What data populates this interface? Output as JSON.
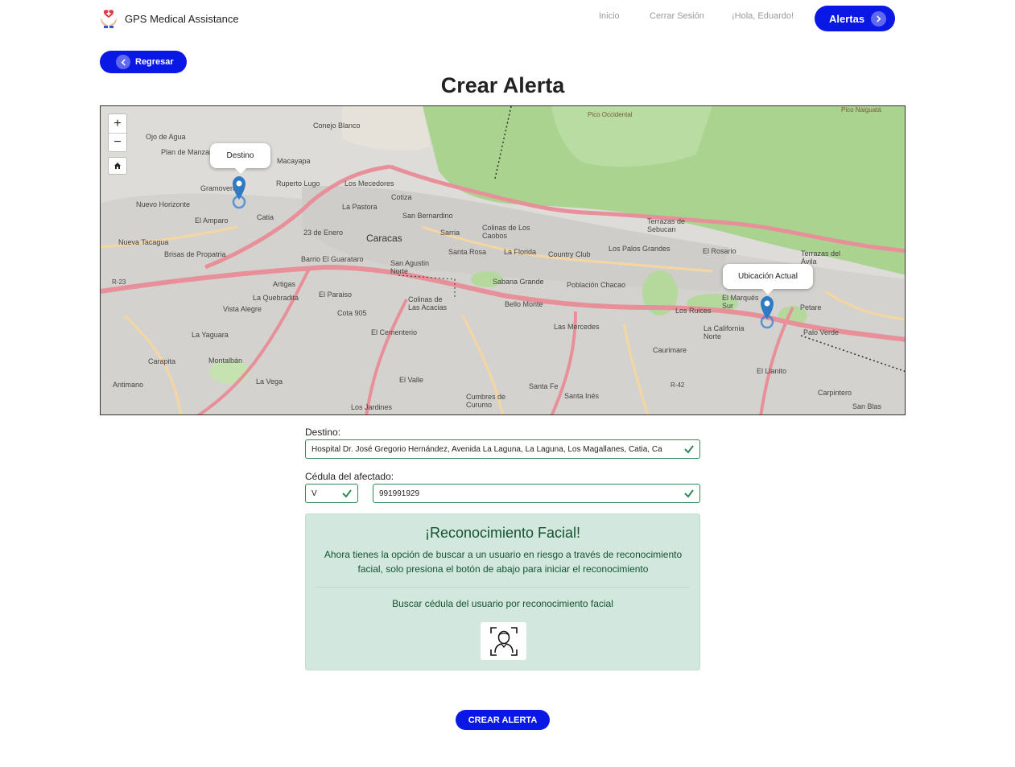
{
  "header": {
    "brand": "GPS Medical Assistance",
    "nav": {
      "home": "Inicio",
      "logout": "Cerrar Sesión",
      "greeting": "¡Hola, Eduardo!"
    },
    "alerts_button": "Alertas"
  },
  "back_button": "Regresar",
  "page_title": "Crear Alerta",
  "map": {
    "zoom_in": "+",
    "zoom_out": "−",
    "destination_popup": "Destino",
    "current_popup": "Ubicación Actual",
    "labels": {
      "caracas": "Caracas",
      "catia": "Catia",
      "gramoven": "Gramoven",
      "macayapa": "Macayapa",
      "ruperto_lugo": "Ruperto Lugo",
      "los_mecedores": "Los Mecedores",
      "conejo_blanco": "Conejo Blanco",
      "ojo_de_agua": "Ojo de Agua",
      "plan_de_manzano": "Plan de Manzano",
      "nuevo_horizonte": "Nuevo Horizonte",
      "el_amparo": "El Amparo",
      "nueva_tacagua": "Nueva Tacagua",
      "brisas_de_propatria": "Brisas de Propatria",
      "cotiza": "Cotiza",
      "la_pastora": "La Pastora",
      "san_bernardino": "San Bernardino",
      "23_de_enero": "23 de Enero",
      "sarria": "Sarria",
      "colinas_de_los_caobos": "Colinas de Los Caobos",
      "barrio_el_guarataro": "Barrio El Guarataro",
      "san_agustin_norte": "San Agustin Norte",
      "santa_rosa": "Santa Rosa",
      "la_florida": "La Florida",
      "country_club": "Country Club",
      "los_palos_grandes": "Los Palos Grandes",
      "el_rosario": "El Rosario",
      "terrazas_de_sebucan": "Terrazas de Sebucan",
      "terrazas_del_avila": "Terrazas del Ávila",
      "artigas": "Artigas",
      "la_quebradita": "La Quebradita",
      "el_paraiso": "El Paraiso",
      "vista_alegre": "Vista Alegre",
      "cota_905": "Cota 905",
      "colinas_de_las_acacias": "Colinas de Las Acacias",
      "sabana_grande": "Sabana Grande",
      "bello_monte": "Bello Monte",
      "poblacion_chacao": "Población Chacao",
      "los_ruices": "Los Ruices",
      "el_marques_sur": "El Marqués Sur",
      "petare": "Petare",
      "palo_verde": "Palo Verde",
      "la_california_norte": "La California Norte",
      "las_mercedes": "Las Mercedes",
      "caurimare": "Caurimare",
      "la_yaguara": "La Yaguara",
      "el_cementerio": "El Cementerio",
      "carapita": "Carapita",
      "montalban": "Montalbán",
      "antimano": "Antimano",
      "la_vega": "La Vega",
      "el_valle": "El Valle",
      "santa_fe": "Santa Fe",
      "santa_ines": "Santa Inés",
      "cumbres_de_curumo": "Cumbres de Curumo",
      "los_jardines": "Los Jardines",
      "el_llanito": "El Llanito",
      "carpintero": "Carpintero",
      "san_blas": "San Blas",
      "pico_occidental": "Pico Occidental",
      "pico_naiguata": "Pico Naiguatá",
      "r23": "R-23",
      "r42": "R-42"
    }
  },
  "form": {
    "destination_label": "Destino:",
    "destination_value": "Hospital Dr. José Gregorio Hernández, Avenida La Laguna, La Laguna, Los Magallanes, Catia, Ca",
    "id_label": "Cédula del afectado:",
    "id_type": "V",
    "id_number": "991991929",
    "valid_color": "#2e8b57"
  },
  "facial": {
    "title": "¡Reconocimiento Facial!",
    "text": "Ahora tienes la opción de buscar a un usuario en riesgo a través de reconocimiento facial, solo presiona el botón de abajo para iniciar el reconocimiento",
    "search_label": "Buscar cédula del usuario por reconocimiento facial",
    "icon": "face-scan-icon"
  },
  "create_button": "CREAR ALERTA",
  "colors": {
    "primary": "#0a18e6",
    "success_bg": "#d2e7de",
    "success_text": "#14532d"
  }
}
